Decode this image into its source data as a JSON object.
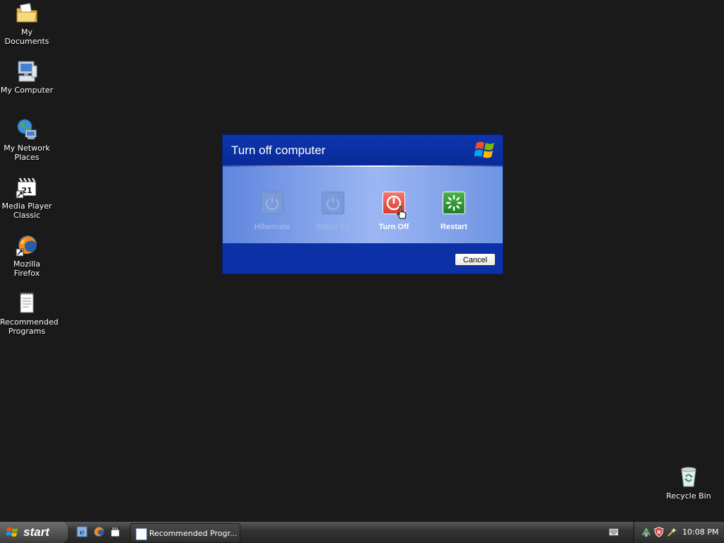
{
  "desktop": {
    "icons": [
      {
        "label": "My Documents"
      },
      {
        "label": "My Computer"
      },
      {
        "label": "My Network Places"
      },
      {
        "label": "Media Player Classic"
      },
      {
        "label": "Mozilla Firefox"
      },
      {
        "label": "Recommended Programs"
      }
    ],
    "recycle_bin": {
      "label": "Recycle Bin"
    }
  },
  "dialog": {
    "title": "Turn off computer",
    "options": [
      {
        "label": "Hibernate",
        "enabled": false
      },
      {
        "label": "Stand By",
        "enabled": false
      },
      {
        "label": "Turn Off",
        "enabled": true
      },
      {
        "label": "Restart",
        "enabled": true
      }
    ],
    "cancel_label": "Cancel"
  },
  "taskbar": {
    "start_label": "start",
    "quick_launch": [
      "internet-explorer-icon",
      "firefox-icon",
      "media-player-icon"
    ],
    "tasks": [
      {
        "label": "Recommended Progr..."
      }
    ],
    "clock": "10:08 PM"
  },
  "colors": {
    "desktop_bg": "#1a1a1a",
    "dialog_blue": "#0a2fa0",
    "turnoff_red": "#e0463a",
    "restart_green": "#2e9b2e"
  }
}
